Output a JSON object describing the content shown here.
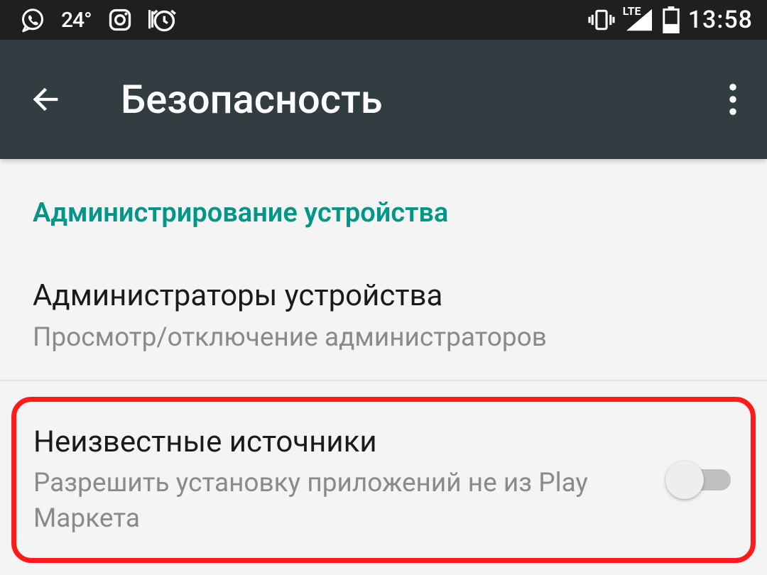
{
  "status": {
    "temperature": "24°",
    "time": "13:58",
    "network_label": "LTE"
  },
  "header": {
    "title": "Безопасность"
  },
  "section": {
    "header": "Администрирование устройства"
  },
  "items": {
    "admins": {
      "title": "Администраторы устройства",
      "subtitle": "Просмотр/отключение администраторов"
    },
    "unknown_sources": {
      "title": "Неизвестные источники",
      "subtitle": "Разрешить установку приложений не из Play Маркета",
      "toggle_on": false
    }
  }
}
